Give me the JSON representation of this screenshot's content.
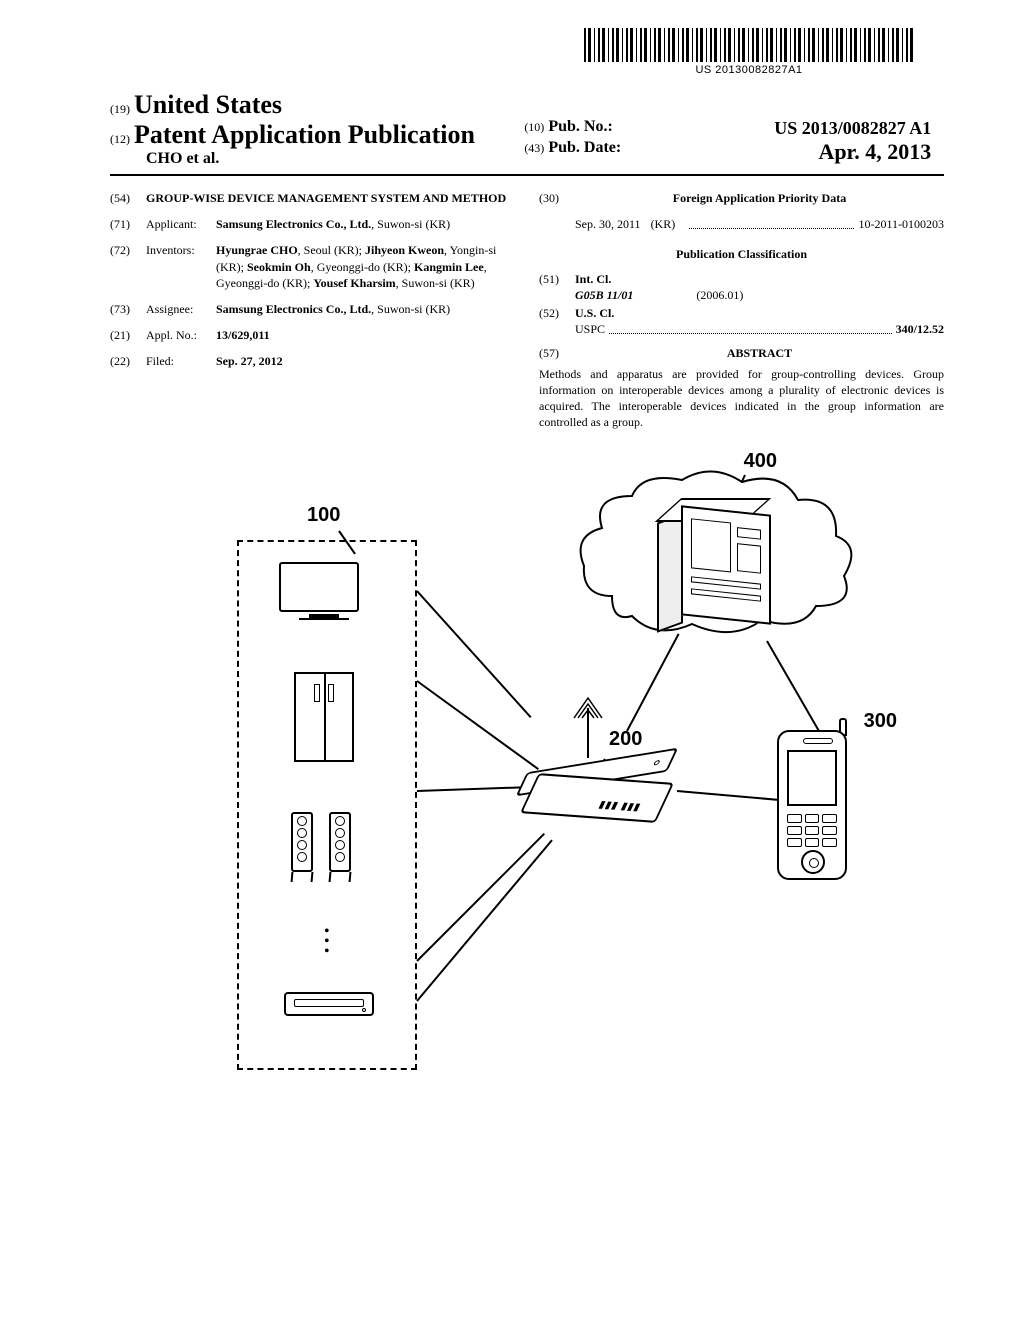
{
  "barcode_text": "US 20130082827A1",
  "header": {
    "code19": "(19)",
    "country": "United States",
    "code12": "(12)",
    "doc_type": "Patent Application Publication",
    "authors_line": "CHO et al.",
    "code10": "(10)",
    "pubno_label": "Pub. No.:",
    "pubno": "US 2013/0082827 A1",
    "code43": "(43)",
    "pubdate_label": "Pub. Date:",
    "pubdate": "Apr. 4, 2013"
  },
  "left_col": {
    "f54": {
      "code": "(54)",
      "title": "GROUP-WISE DEVICE MANAGEMENT SYSTEM AND METHOD"
    },
    "f71": {
      "code": "(71)",
      "label": "Applicant:",
      "value": "Samsung Electronics Co., Ltd.",
      "loc": "Suwon-si (KR)"
    },
    "f72": {
      "code": "(72)",
      "label": "Inventors:",
      "lines": [
        {
          "name": "Hyungrae CHO",
          "loc": ", Seoul (KR); "
        },
        {
          "name": "Jihyeon Kweon",
          "loc": ", Yongin-si (KR); "
        },
        {
          "name": "Seokmin Oh",
          "loc": ", Gyeonggi-do (KR); "
        },
        {
          "name": "Kangmin Lee",
          "loc": ", Gyeonggi-do (KR); "
        },
        {
          "name": "Yousef Kharsim",
          "loc": ", Suwon-si (KR)"
        }
      ]
    },
    "f73": {
      "code": "(73)",
      "label": "Assignee:",
      "value": "Samsung Electronics Co., Ltd.",
      "loc": "Suwon-si (KR)"
    },
    "f21": {
      "code": "(21)",
      "label": "Appl. No.:",
      "value": "13/629,011"
    },
    "f22": {
      "code": "(22)",
      "label": "Filed:",
      "value": "Sep. 27, 2012"
    }
  },
  "right_col": {
    "f30": {
      "code": "(30)",
      "title": "Foreign Application Priority Data",
      "date": "Sep. 30, 2011",
      "cc": "(KR)",
      "appno": "10-2011-0100203"
    },
    "pub_class": "Publication Classification",
    "f51": {
      "code": "(51)",
      "label": "Int. Cl.",
      "cls": "G05B 11/01",
      "edition": "(2006.01)"
    },
    "f52": {
      "code": "(52)",
      "label": "U.S. Cl.",
      "prefix": "USPC",
      "value": "340/12.52"
    },
    "f57": {
      "code": "(57)",
      "title": "ABSTRACT",
      "text": "Methods and apparatus are provided for group-controlling devices. Group information on interoperable devices among a plurality of electronic devices is acquired. The interoperable devices indicated in the group information are controlled as a group."
    }
  },
  "figure": {
    "labels": {
      "devices": "100",
      "router": "200",
      "phone": "300",
      "cloud": "400"
    }
  }
}
